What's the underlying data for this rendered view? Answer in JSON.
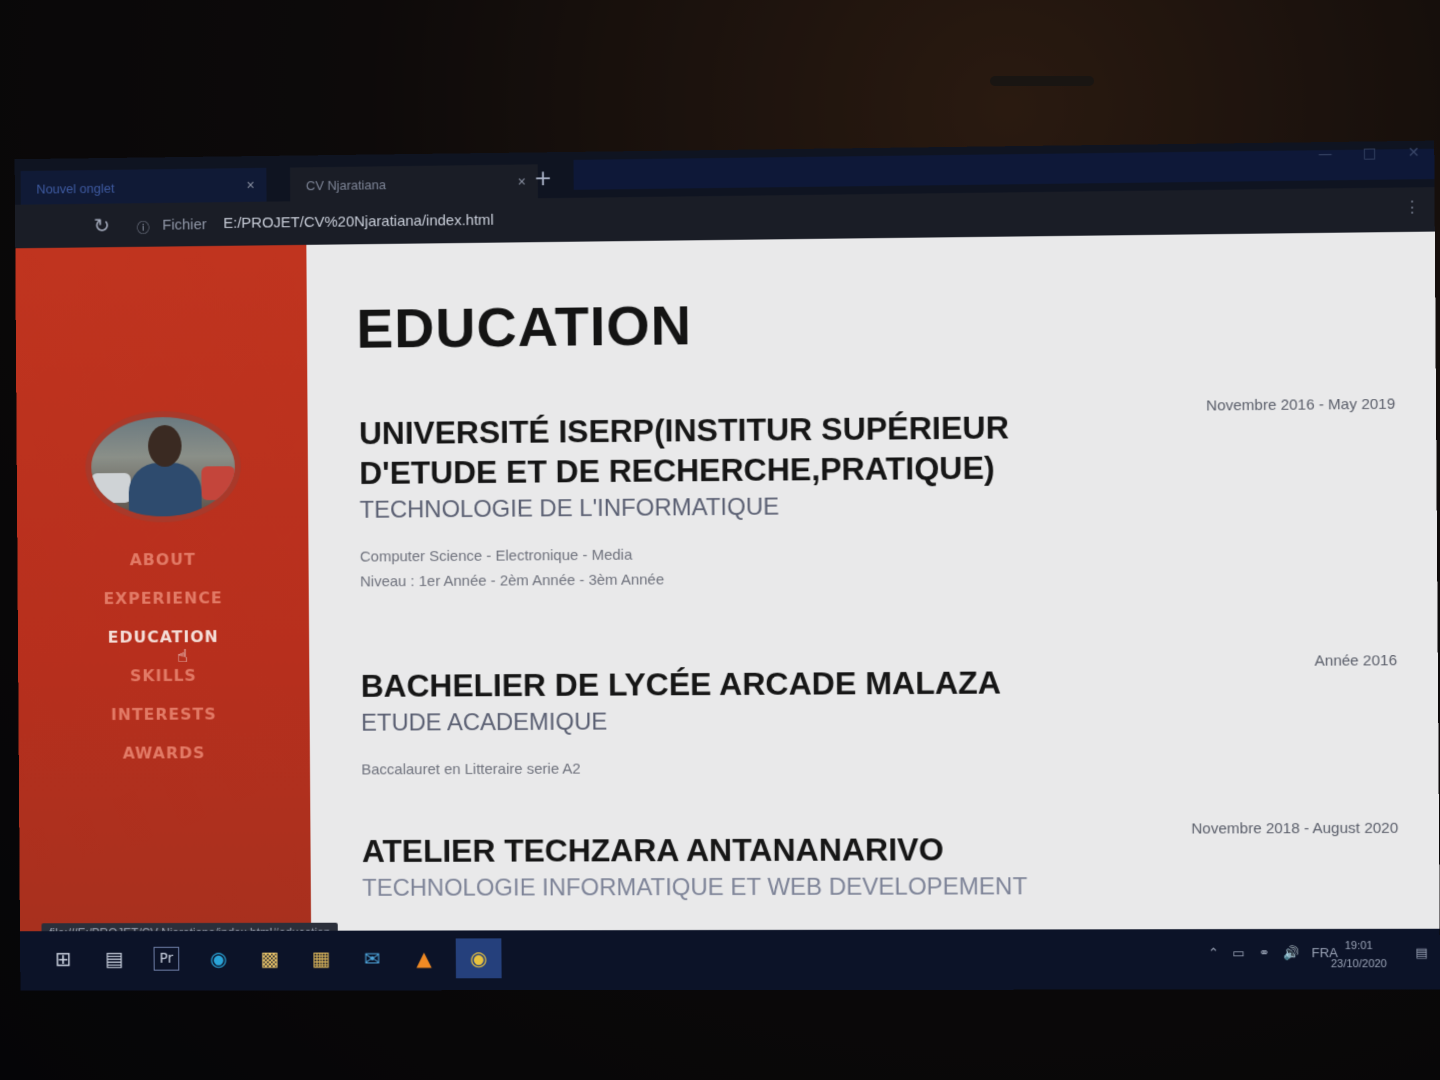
{
  "browser": {
    "tabs": [
      {
        "label": "Nouvel onglet"
      },
      {
        "label": "CV Njaratiana"
      }
    ],
    "new_tab_symbol": "+",
    "close_symbol": "×",
    "site_info_label": "Fichier",
    "url": "E:/PROJET/CV%20Njaratiana/index.html",
    "status_url": "file:///E:/PROJET/CV Njaratiana/index.html#education"
  },
  "sidebar": {
    "nav": [
      {
        "label": "ABOUT"
      },
      {
        "label": "EXPERIENCE"
      },
      {
        "label": "EDUCATION"
      },
      {
        "label": "SKILLS"
      },
      {
        "label": "INTERESTS"
      },
      {
        "label": "AWARDS"
      }
    ],
    "active_index": 2
  },
  "main": {
    "heading": "EDUCATION",
    "entries": [
      {
        "title": "UNIVERSITÉ ISERP(INSTITUR SUPÉRIEUR D'ETUDE ET DE RECHERCHE,PRATIQUE)",
        "subtitle": "TECHNOLOGIE DE L'INFORMATIQUE",
        "desc_line1": "Computer Science - Electronique - Media",
        "desc_line2": "Niveau : 1er Année - 2èm Année - 3èm Année",
        "date": "Novembre 2016 - May 2019"
      },
      {
        "title": "BACHELIER DE LYCÉE ARCADE MALAZA",
        "subtitle": "ETUDE ACADEMIQUE",
        "desc_line1": "Baccalauret en Litteraire serie A2",
        "date": "Année 2016"
      },
      {
        "title": "ATELIER TECHZARA ANTANANARIVO",
        "subtitle": "TECHNOLOGIE INFORMATIQUE ET WEB DEVELOPEMENT",
        "date": "Novembre 2018 - August 2020"
      }
    ]
  },
  "taskbar": {
    "apps": [
      "windows-start",
      "task-view",
      "premiere",
      "edge",
      "file-explorer",
      "store",
      "mail",
      "vlc",
      "chrome"
    ],
    "premiere_label": "Pr",
    "language": "FRA",
    "time": "19:01",
    "date": "23/10/2020"
  },
  "colors": {
    "sidebar": "#c0341f",
    "page_bg": "#e9e9ea",
    "nav_inactive": "#e27a66",
    "nav_active": "#f4ddd7"
  }
}
